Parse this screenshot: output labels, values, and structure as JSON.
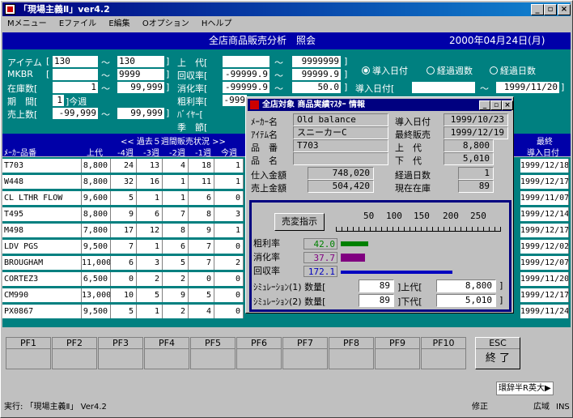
{
  "window": {
    "title": "「現場主義Ⅱ」ver4.2",
    "min": "_",
    "max": "▫",
    "close": "×"
  },
  "menu": [
    "Mメニュー",
    "Eファイル",
    "E編集",
    "Oオプション",
    "Hヘルプ"
  ],
  "header": {
    "title": "全店商品販売分析　照会",
    "date": "2000年04月24日(月)"
  },
  "form": {
    "item_label": "アイテム",
    "item_from": "130",
    "item_to": "130",
    "mkbr_label": "MKBR",
    "mkbr_to": "9999",
    "stock_label": "在庫数[",
    "stock_from": "1",
    "stock_to": "99,999",
    "period_label": "期　間[",
    "period_val": "1",
    "period_unit": "]今週",
    "sales_label": "売上数[",
    "sales_from": "-99,999",
    "sales_to": "99,999",
    "price_label": "上　代[",
    "price_to": "9999999",
    "turn_label": "回収率[",
    "turn_from": "-99999.9",
    "turn_to": "99999.9",
    "digest_label": "消化率[",
    "digest_from": "-99999.9",
    "digest_to": "50.0",
    "margin_label": "粗利率[",
    "margin_from": "-999",
    "buyer_label": "ﾊﾞｲﾔｰ[",
    "season_label": "季　節[",
    "tilde": "～",
    "radio1": "導入日付",
    "radio2": "経過週数",
    "radio3": "経過日数",
    "intro_label": "導入日付[",
    "intro_to": "1999/11/20"
  },
  "grid_header": {
    "weeks": "<< 過去５週間販売状況 >>",
    "maker": "ﾒｰｶｰ品番",
    "price": "上代",
    "w4": "-4週",
    "w3": "-3週",
    "w2": "-2週",
    "w1": "-1週",
    "now": "今週",
    "last_top": "最終",
    "last_bot": "導入日付"
  },
  "rows": [
    {
      "code": "T703",
      "price": "8,800",
      "w": [
        "24",
        "13",
        "4",
        "18",
        "1"
      ],
      "d": "1999/12/18"
    },
    {
      "code": "W448",
      "price": "8,800",
      "w": [
        "32",
        "16",
        "1",
        "11",
        "1"
      ],
      "d": "1999/12/17"
    },
    {
      "code": "CL LTHR FLOW",
      "price": "9,600",
      "w": [
        "5",
        "1",
        "1",
        "6",
        "0"
      ],
      "d": "1999/11/07"
    },
    {
      "code": "T495",
      "price": "8,800",
      "w": [
        "9",
        "6",
        "7",
        "8",
        "3"
      ],
      "d": "1999/12/14"
    },
    {
      "code": "M498",
      "price": "7,800",
      "w": [
        "17",
        "12",
        "8",
        "9",
        "1"
      ],
      "d": "1999/12/17"
    },
    {
      "code": "LDV PGS",
      "price": "9,500",
      "w": [
        "7",
        "1",
        "6",
        "7",
        "0"
      ],
      "d": "1999/12/02"
    },
    {
      "code": "BROUGHAM",
      "price": "11,000",
      "w": [
        "6",
        "3",
        "5",
        "7",
        "2"
      ],
      "d": "1999/12/07"
    },
    {
      "code": "CORTEZ3",
      "price": "6,500",
      "w": [
        "0",
        "2",
        "2",
        "0",
        "0"
      ],
      "d": "1999/11/20"
    },
    {
      "code": "CM990",
      "price": "13,000",
      "w": [
        "10",
        "5",
        "9",
        "5",
        "0"
      ],
      "d": "1999/12/17"
    },
    {
      "code": "PX0867",
      "price": "9,500",
      "w": [
        "5",
        "1",
        "2",
        "4",
        "0"
      ],
      "d": "1999/11/24"
    }
  ],
  "fkeys": [
    "PF1",
    "PF2",
    "PF3",
    "PF4",
    "PF5",
    "PF6",
    "PF7",
    "PF8",
    "PF9",
    "PF10"
  ],
  "esc": {
    "top": "ESC",
    "bot": "終 了"
  },
  "ime": "環辞半R英大▶",
  "status": {
    "left": "実行: 「現場主義Ⅱ」 Ver4.2",
    "mid": "修正",
    "right1": "広域",
    "right2": "INS"
  },
  "popup": {
    "title": "全店対象 商品実績ﾏｽﾀｰ 情報",
    "maker_label": "ﾒｰｶｰ名",
    "maker": "Old balance",
    "item_label": "ｱｲﾃﾑ名",
    "item": "スニーカーC",
    "code_label": "品　番",
    "code": "T703",
    "name_label": "品　名",
    "name": "",
    "intro_label": "導入日付",
    "intro": "1999/10/23",
    "last_label": "最終販売",
    "last": "1999/12/19",
    "upper_label": "上　代",
    "upper": "8,800",
    "lower_label": "下　代",
    "lower": "5,010",
    "cost_label": "仕入金額",
    "cost": "748,020",
    "sales_label": "売上金額",
    "sales": "504,420",
    "days_label": "経過日数",
    "days": "1",
    "stock_label": "現在在庫",
    "stock": "89",
    "sim_button": "売変指示",
    "ruler": [
      "50",
      "100",
      "150",
      "200",
      "250"
    ],
    "margin_label": "粗利率",
    "margin": "42.0",
    "digest_label": "消化率",
    "digest": "37.7",
    "turn_label": "回収率",
    "turn": "172.1",
    "margin_color": "#008000",
    "digest_color": "#800080",
    "turn_color": "#0000c0",
    "sim1_label": "ｼﾐｭﾚｰｼｮﾝ(1) 数量[",
    "sim1_qty": "89",
    "sim1_mid": "]上代[",
    "sim1_price": "8,800",
    "sim2_label": "ｼﾐｭﾚｰｼｮﾝ(2) 数量[",
    "sim2_qty": "89",
    "sim2_mid": "]下代[",
    "sim2_price": "5,010",
    "close_br": "]"
  }
}
